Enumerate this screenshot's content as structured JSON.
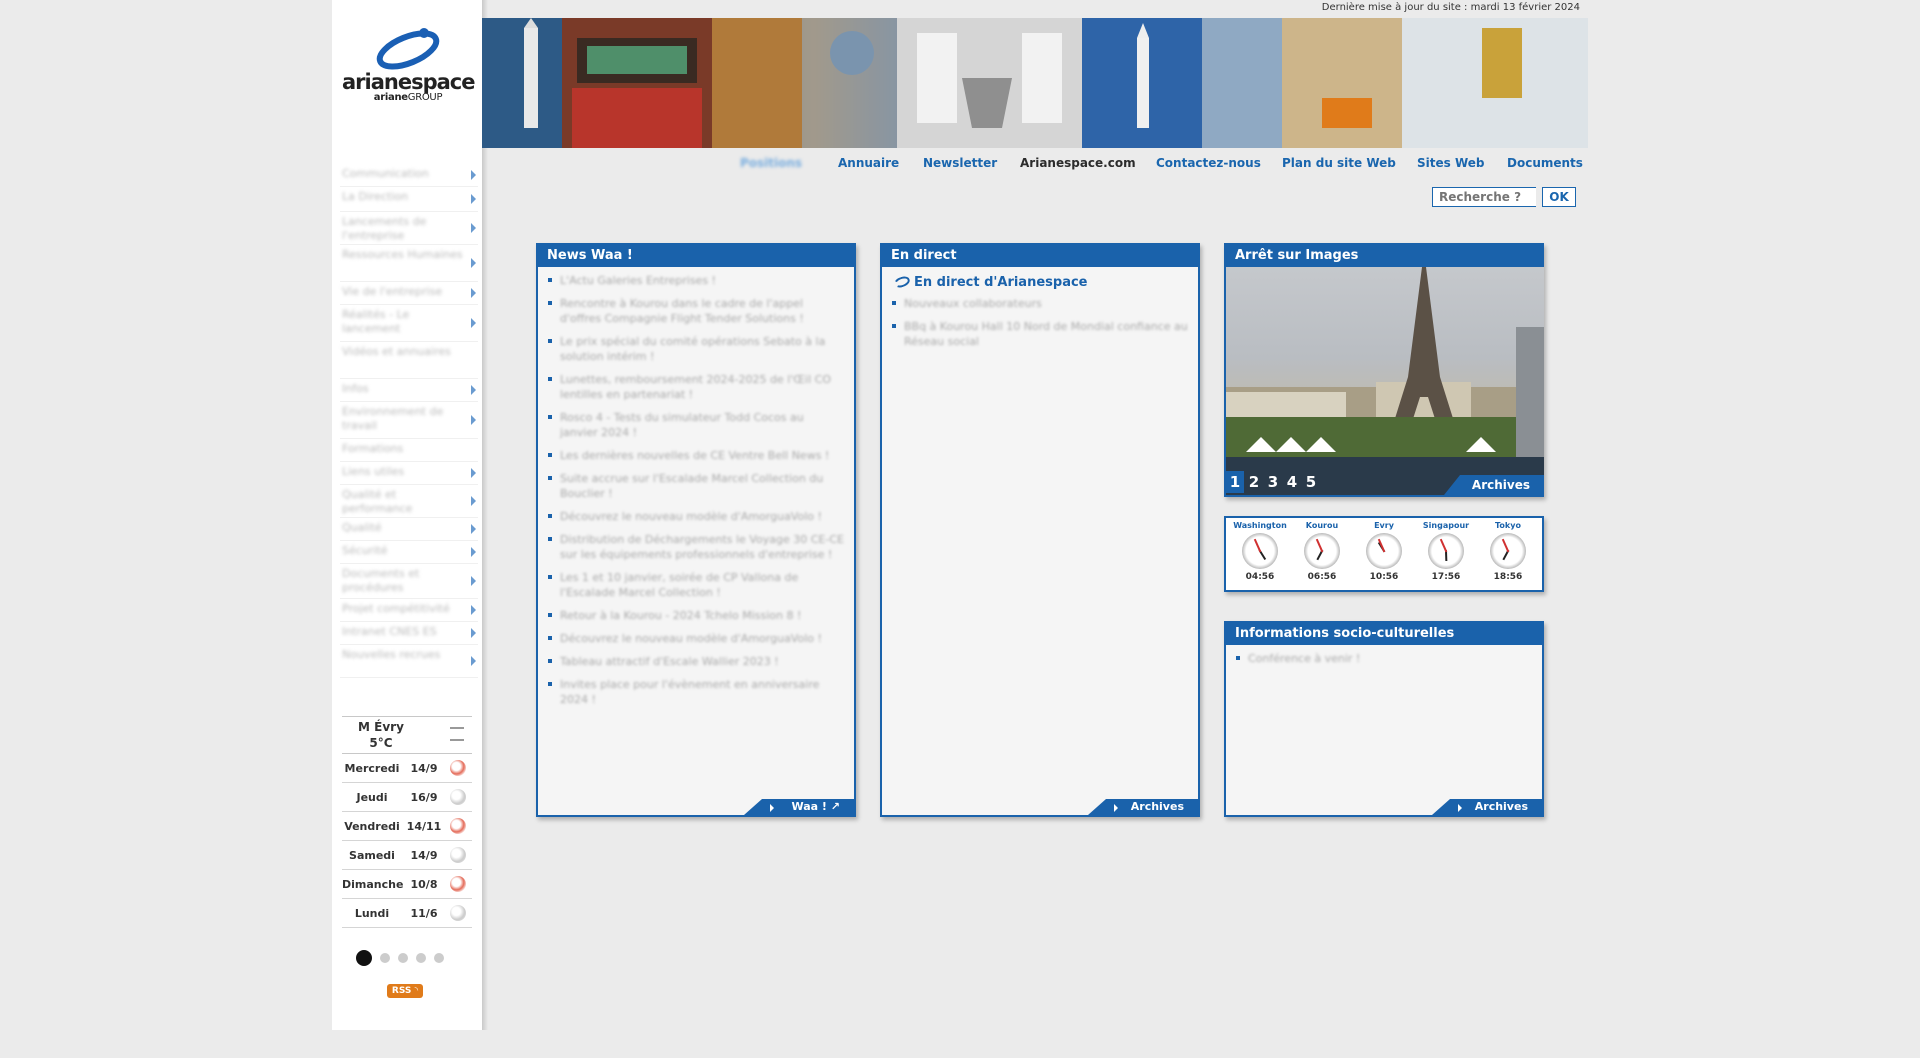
{
  "header": {
    "last_update": "Dernière mise à jour du site : mardi 13 février 2024"
  },
  "logo": {
    "name": "arianespace",
    "sub_prefix": "ariane",
    "sub_suffix": "GROUP"
  },
  "nav": {
    "items": [
      {
        "label": "Positions",
        "blurred": true
      },
      {
        "label": "Annuaire"
      },
      {
        "label": "Newsletter"
      },
      {
        "label": "Arianespace.com",
        "dark": true
      },
      {
        "label": "Contactez-nous"
      },
      {
        "label": "Plan du site Web"
      },
      {
        "label": "Sites Web"
      },
      {
        "label": "Documents"
      }
    ]
  },
  "search": {
    "placeholder": "Recherche ?",
    "button": "OK"
  },
  "sidebar": {
    "menu": [
      {
        "label": "Communication",
        "arrow": true
      },
      {
        "label": "La Direction",
        "arrow": true
      },
      {
        "label": "Lancements de l'entreprise",
        "arrow": true
      },
      {
        "label": "Ressources Humaines",
        "arrow": true
      },
      {
        "label": "Vie de l'entreprise",
        "arrow": true
      },
      {
        "label": "Réalités - Le lancement",
        "arrow": true
      },
      {
        "label": "Vidéos et annuaires",
        "arrow": false
      },
      {
        "label": "Infos",
        "arrow": true
      },
      {
        "label": "Environnement de travail",
        "arrow": true
      },
      {
        "label": "Formations",
        "arrow": false
      },
      {
        "label": "Liens utiles",
        "arrow": true
      },
      {
        "label": "Qualité et performance",
        "arrow": true
      },
      {
        "label": "Qualité",
        "arrow": true
      },
      {
        "label": "Sécurité",
        "arrow": true
      },
      {
        "label": "Documents et procédures",
        "arrow": true
      },
      {
        "label": "Projet compétitivité",
        "arrow": true
      },
      {
        "label": "Intranet CNES ES",
        "arrow": true
      },
      {
        "label": "Nouvelles recrues",
        "arrow": true
      }
    ],
    "weather": {
      "city": "M Évry",
      "temp": "5°C",
      "days": [
        {
          "day": "Mercredi",
          "value": "14/9",
          "icon": "rain-icon"
        },
        {
          "day": "Jeudi",
          "value": "16/9",
          "icon": "cloud-icon"
        },
        {
          "day": "Vendredi",
          "value": "14/11",
          "icon": "rain-icon"
        },
        {
          "day": "Samedi",
          "value": "14/9",
          "icon": "cloud-icon"
        },
        {
          "day": "Dimanche",
          "value": "10/8",
          "icon": "rain-icon"
        },
        {
          "day": "Lundi",
          "value": "11/6",
          "icon": "cloud-icon"
        }
      ]
    },
    "rss": "RSS"
  },
  "panels": {
    "news": {
      "title": "News Waa !",
      "items": [
        "L'Actu Galeries Entreprises !",
        "Rencontre à Kourou dans le cadre de l'appel d'offres Compagnie Flight Tender Solutions !",
        "Le prix spécial du comité opérations Sebato à la solution intérim !",
        "Lunettes, remboursement 2024-2025 de l'Œil CO lentilles en partenariat !",
        "Rosco 4 - Tests du simulateur Todd Cocos au janvier 2024 !",
        "Les dernières nouvelles de CE Ventre Bell News !",
        "Suite accrue sur l'Escalade Marcel Collection du Bouclier !",
        "Découvrez le nouveau modèle d'AmorguaVolo !",
        "Distribution de Déchargements le Voyage 30 CE-CE sur les équipements professionnels d'entreprise !",
        "Les 1 et 10 janvier, soirée de CP Vallona de l'Escalade Marcel Collection !",
        "Retour à la Kourou - 2024 Tchelo Mission 8 !",
        "Découvrez le nouveau modèle d'AmorguaVolo !",
        "Tableau attractif d'Escale Wallier 2023 !",
        "Invites place pour l'évènement en anniversaire 2024 !"
      ],
      "footer": "Waa ! ↗"
    },
    "direct": {
      "title": "En direct",
      "headline": "En direct d'Arianespace",
      "items": [
        "Nouveaux collaborateurs",
        "BBq à Kourou Hall 10 Nord de Mondial confiance au Réseau social"
      ],
      "footer": "Archives"
    },
    "images": {
      "title": "Arrêt sur Images",
      "pages": [
        "1",
        "2",
        "3",
        "4",
        "5"
      ],
      "active_page": "1",
      "archives": "Archives"
    },
    "clocks": [
      {
        "city": "Washington",
        "time": "04:56"
      },
      {
        "city": "Kourou",
        "time": "06:56"
      },
      {
        "city": "Evry",
        "time": "10:56"
      },
      {
        "city": "Singapour",
        "time": "17:56"
      },
      {
        "city": "Tokyo",
        "time": "18:56"
      }
    ],
    "culture": {
      "title": "Informations socio-culturelles",
      "items": [
        "Conférence à venir !"
      ],
      "footer": "Archives"
    }
  },
  "colors": {
    "brand_blue": "#1a62ab",
    "link_blue": "#1a66ae",
    "rss_orange": "#e07b1a"
  }
}
